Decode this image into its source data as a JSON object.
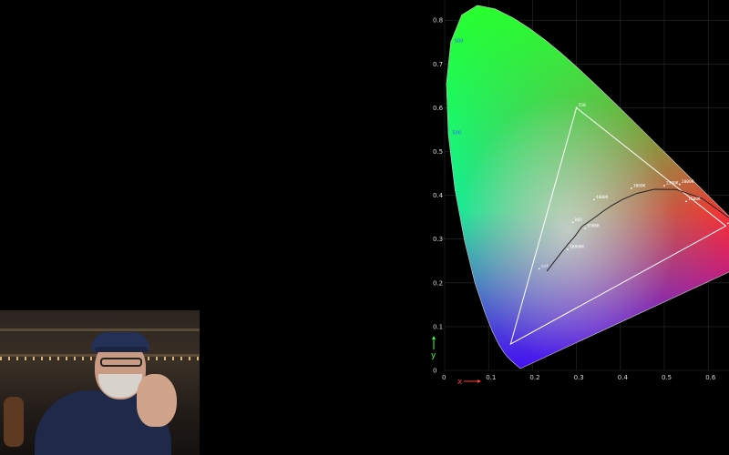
{
  "chart_data": {
    "type": "chromaticity-diagram",
    "title": "",
    "xlabel": "x",
    "ylabel": "y",
    "xlim": [
      0,
      0.65
    ],
    "ylim": [
      0,
      0.85
    ],
    "grid": true,
    "x_ticks": [
      "0",
      "0.1",
      "0.2",
      "0.3",
      "0.4",
      "0.5",
      "0.6"
    ],
    "y_ticks": [
      "0",
      "0.1",
      "0.2",
      "0.3",
      "0.4",
      "0.5",
      "0.6",
      "0.7",
      "0.8"
    ],
    "spectral_locus": [
      [
        0.1741,
        0.005
      ],
      [
        0.1738,
        0.0049
      ],
      [
        0.1736,
        0.0049
      ],
      [
        0.173,
        0.0048
      ],
      [
        0.1721,
        0.0048
      ],
      [
        0.1703,
        0.0058
      ],
      [
        0.1666,
        0.0089
      ],
      [
        0.1611,
        0.0138
      ],
      [
        0.1566,
        0.0177
      ],
      [
        0.151,
        0.0227
      ],
      [
        0.144,
        0.0297
      ],
      [
        0.1355,
        0.0399
      ],
      [
        0.1241,
        0.0578
      ],
      [
        0.1096,
        0.0868
      ],
      [
        0.0913,
        0.1327
      ],
      [
        0.0687,
        0.2007
      ],
      [
        0.0454,
        0.295
      ],
      [
        0.0235,
        0.4127
      ],
      [
        0.0082,
        0.5384
      ],
      [
        0.0039,
        0.6548
      ],
      [
        0.0139,
        0.7502
      ],
      [
        0.0389,
        0.812
      ],
      [
        0.0743,
        0.8338
      ],
      [
        0.1142,
        0.8262
      ],
      [
        0.1547,
        0.8059
      ],
      [
        0.1929,
        0.7816
      ],
      [
        0.2296,
        0.7543
      ],
      [
        0.2658,
        0.7243
      ],
      [
        0.3016,
        0.6923
      ],
      [
        0.3373,
        0.6589
      ],
      [
        0.3731,
        0.6245
      ],
      [
        0.4087,
        0.5896
      ],
      [
        0.4441,
        0.5547
      ],
      [
        0.4788,
        0.5202
      ],
      [
        0.5125,
        0.4866
      ],
      [
        0.5448,
        0.4544
      ],
      [
        0.5752,
        0.4242
      ],
      [
        0.6029,
        0.3965
      ],
      [
        0.627,
        0.3725
      ],
      [
        0.6482,
        0.3514
      ],
      [
        0.6658,
        0.334
      ],
      [
        0.6801,
        0.3197
      ],
      [
        0.6915,
        0.3083
      ],
      [
        0.7006,
        0.2993
      ],
      [
        0.7079,
        0.292
      ],
      [
        0.714,
        0.2859
      ],
      [
        0.719,
        0.2809
      ],
      [
        0.723,
        0.277
      ],
      [
        0.726,
        0.274
      ],
      [
        0.7283,
        0.2717
      ],
      [
        0.73,
        0.27
      ],
      [
        0.7311,
        0.2689
      ],
      [
        0.732,
        0.268
      ],
      [
        0.7334,
        0.2666
      ],
      [
        0.7344,
        0.2656
      ],
      [
        0.7347,
        0.2653
      ]
    ],
    "gamut_triangle": [
      [
        0.64,
        0.33
      ],
      [
        0.3,
        0.6
      ],
      [
        0.15,
        0.06
      ]
    ],
    "planckian_locus": [
      [
        0.6528,
        0.3444
      ],
      [
        0.5857,
        0.3931
      ],
      [
        0.5267,
        0.4133
      ],
      [
        0.477,
        0.4137
      ],
      [
        0.4369,
        0.4041
      ],
      [
        0.4053,
        0.3907
      ],
      [
        0.3805,
        0.3768
      ],
      [
        0.3608,
        0.3636
      ],
      [
        0.3451,
        0.3516
      ],
      [
        0.3127,
        0.329
      ],
      [
        0.2952,
        0.3048
      ],
      [
        0.2807,
        0.2883
      ],
      [
        0.2637,
        0.267
      ],
      [
        0.2477,
        0.2462
      ],
      [
        0.2325,
        0.2265
      ]
    ],
    "point_labels": [
      {
        "text": "550",
        "x": 0.3,
        "y": 0.6
      },
      {
        "text": "3000K",
        "x": 0.425,
        "y": 0.416
      },
      {
        "text": "2500K",
        "x": 0.5,
        "y": 0.422
      },
      {
        "text": "2000K",
        "x": 0.535,
        "y": 0.425
      },
      {
        "text": "1500K",
        "x": 0.55,
        "y": 0.386
      },
      {
        "text": "1000K",
        "x": 0.645,
        "y": 0.336
      },
      {
        "text": "4000K",
        "x": 0.34,
        "y": 0.39
      },
      {
        "text": "D65",
        "x": 0.292,
        "y": 0.338
      },
      {
        "text": "6500K",
        "x": 0.32,
        "y": 0.324
      },
      {
        "text": "10000K",
        "x": 0.28,
        "y": 0.276
      },
      {
        "text": "inf",
        "x": 0.215,
        "y": 0.232
      }
    ],
    "wavelength_labels": [
      {
        "text": "500",
        "x": 0.01,
        "y": 0.75
      },
      {
        "text": "500",
        "x": 0.005,
        "y": 0.54
      }
    ],
    "axis_letter_colors": {
      "x": "#ff3b3b",
      "y": "#3bff3b"
    }
  },
  "webcam": {
    "icon": "webcam-presenter"
  }
}
